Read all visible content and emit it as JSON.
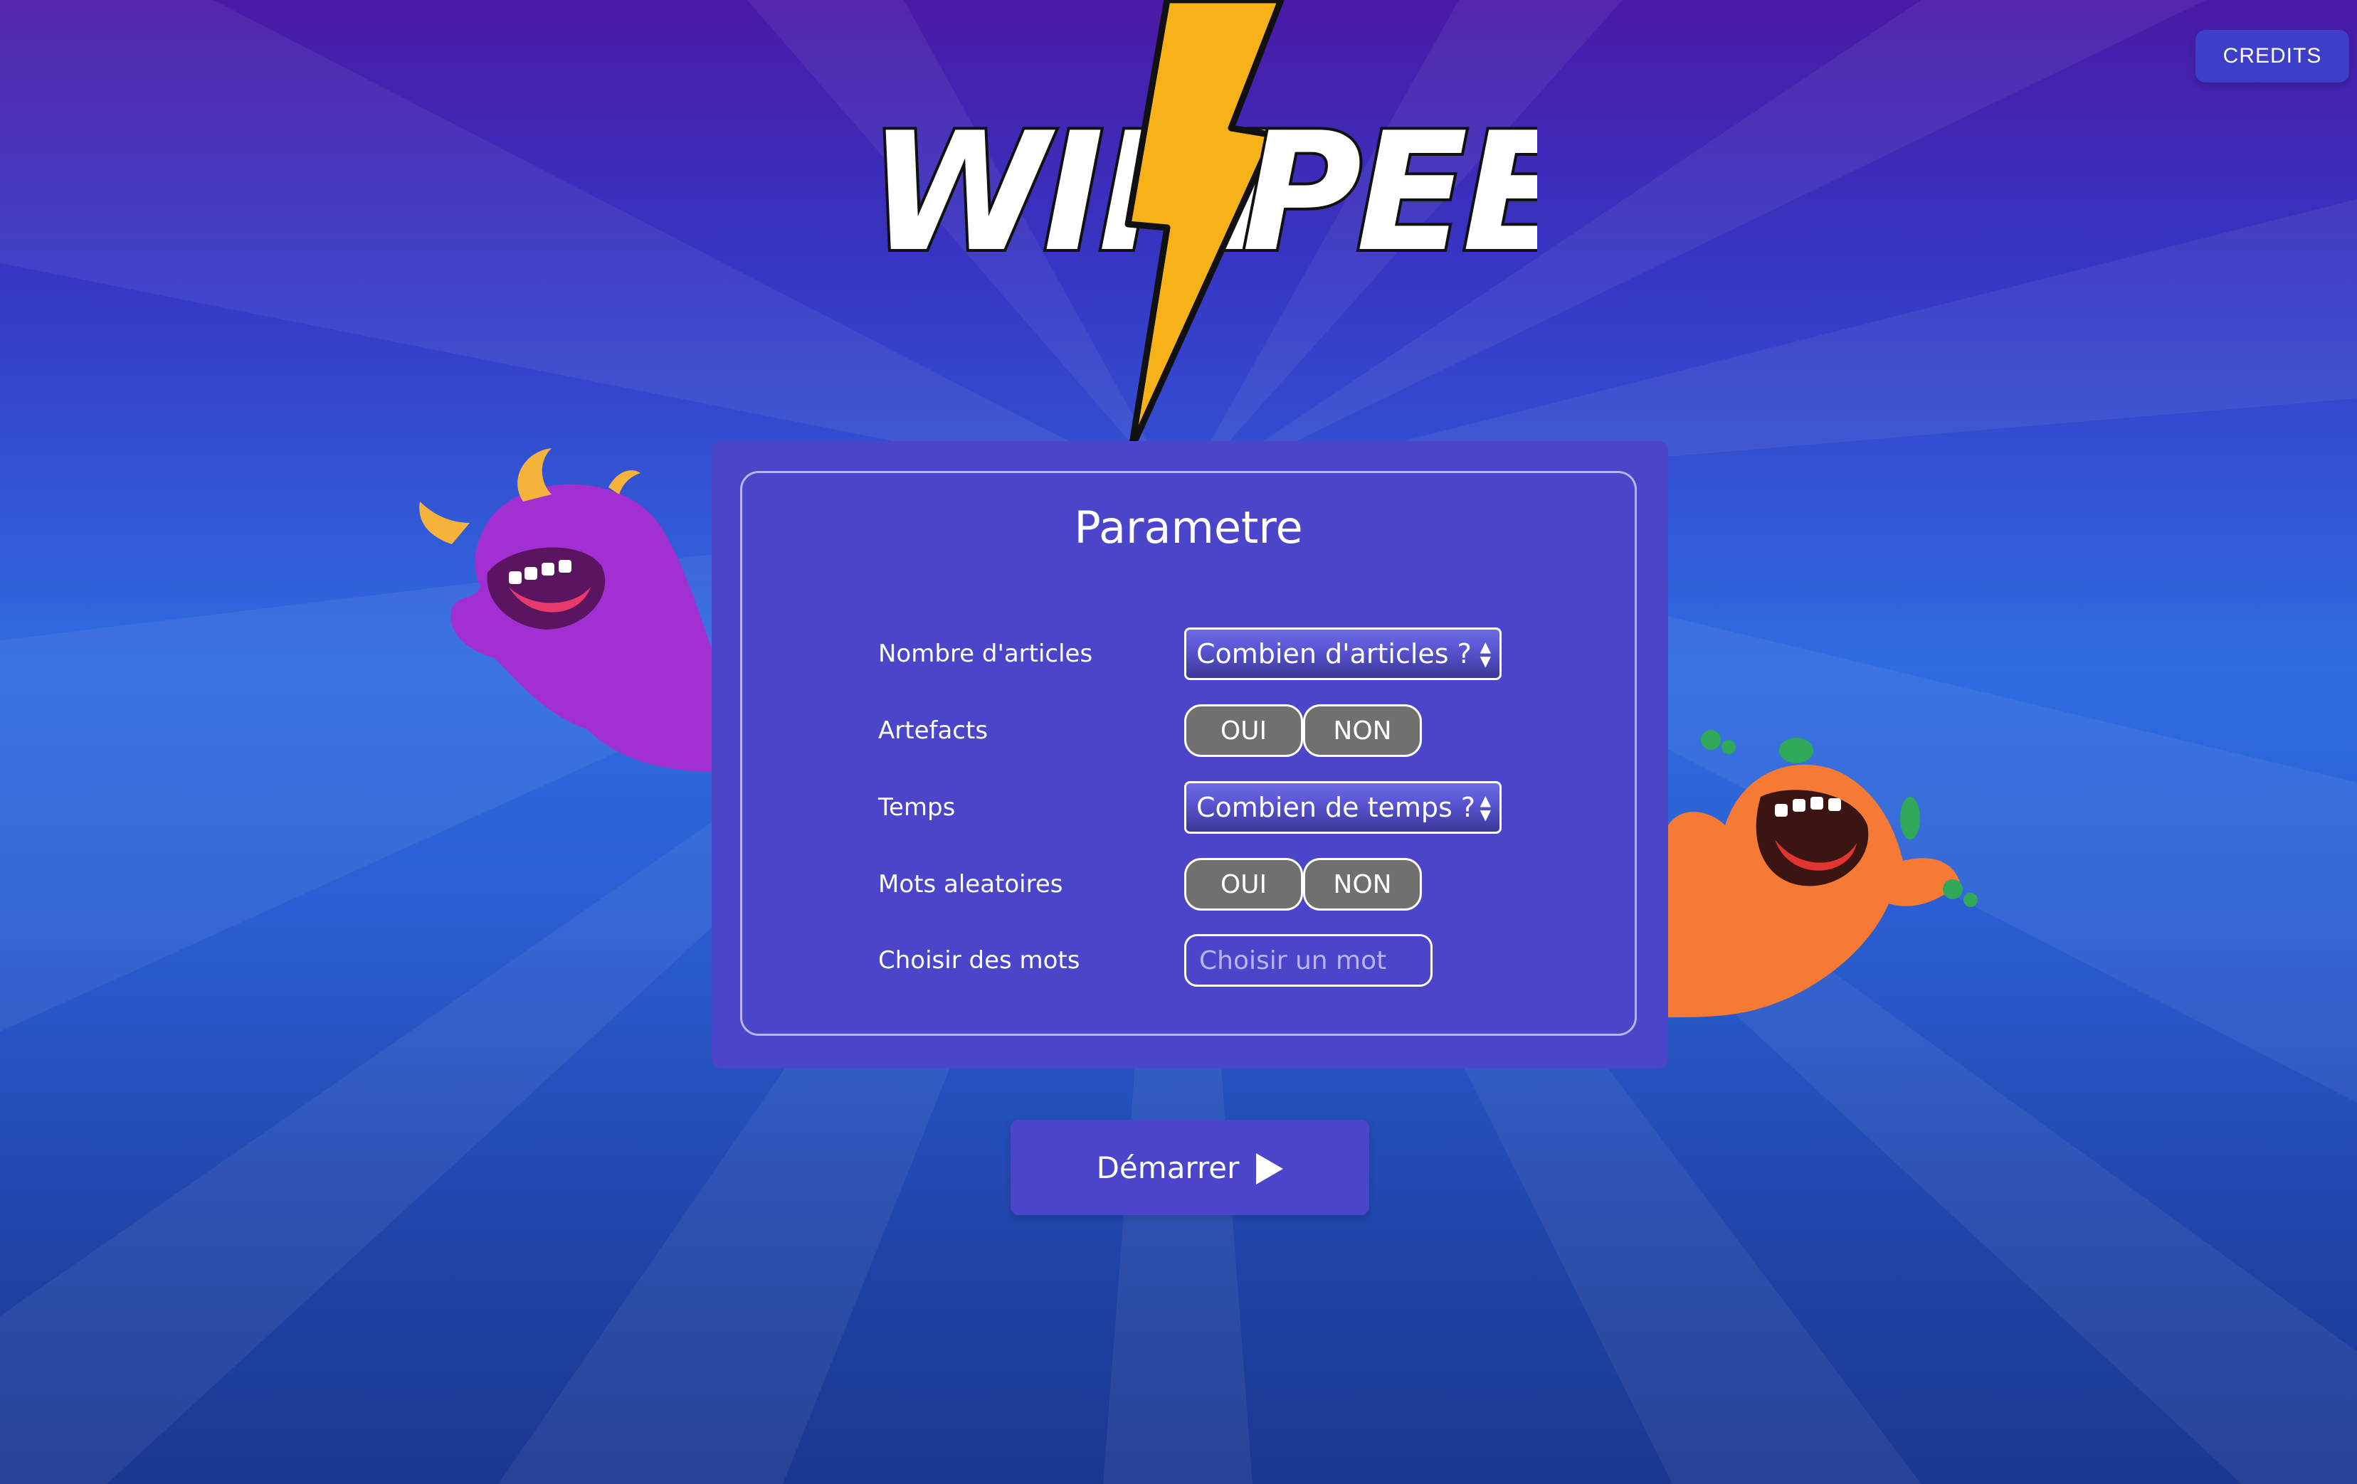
{
  "logo": {
    "text_left": "WIKI",
    "text_right": "PEED"
  },
  "header": {
    "credits_label": "CREDITS"
  },
  "panel": {
    "title": "Parametre",
    "rows": [
      {
        "label": "Nombre d'articles",
        "control": "select",
        "value": "Combien d'articles ?"
      },
      {
        "label": "Artefacts",
        "control": "toggle",
        "options": [
          "OUI",
          "NON"
        ]
      },
      {
        "label": "Temps",
        "control": "select",
        "value": "Combien de temps ?"
      },
      {
        "label": "Mots aleatoires",
        "control": "toggle",
        "options": [
          "OUI",
          "NON"
        ]
      },
      {
        "label": "Choisir des mots",
        "control": "input",
        "placeholder": "Choisir un mot"
      }
    ]
  },
  "start": {
    "label": "Démarrer"
  },
  "colors": {
    "panel": "#4a45c9",
    "toggle": "#707070",
    "bolt": "#f7b21a",
    "monster_left": "#a22fd2",
    "monster_right": "#f57a35"
  },
  "icons": [
    "play-icon",
    "select-arrows-icon",
    "lightning-bolt-icon"
  ]
}
